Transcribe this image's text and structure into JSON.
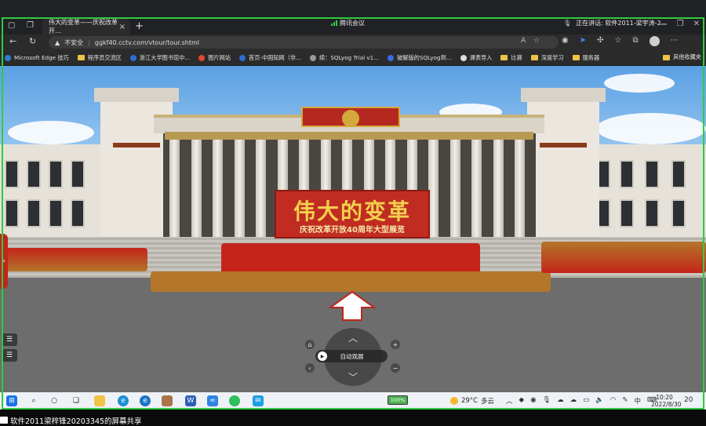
{
  "browser": {
    "tab_title": "伟大的变革——庆祝改革开…",
    "meeting_label": "腾讯会议",
    "speaking_label": "正在讲话: 软件2011-梁宇涛-2...",
    "security_warning": "不安全",
    "url": "ggkf40.cctv.com/vtour/tour.shtml"
  },
  "bookmarks": [
    {
      "label": "Microsoft Edge 技巧",
      "icon": "edge-icon",
      "color": "#2f7fd8"
    },
    {
      "label": "程序员交流区",
      "icon": "folder-icon",
      "color": "#f0c246"
    },
    {
      "label": "浙江大学图书馆中...",
      "icon": "zju-icon",
      "color": "#2d6fd6"
    },
    {
      "label": "图片网站",
      "icon": "site-icon",
      "color": "#e04a2f"
    },
    {
      "label": "首页-中国知网（非...",
      "icon": "cnki-icon",
      "color": "#2f6bd1"
    },
    {
      "label": "续：SQLyog Trial v1...",
      "icon": "sqlyog-icon",
      "color": "#999999"
    },
    {
      "label": "破解版的SQLyog到...",
      "icon": "zhihu-icon",
      "color": "#3a6be0"
    },
    {
      "label": "课表导入",
      "icon": "page-icon",
      "color": "#dddddd"
    },
    {
      "label": "比赛",
      "icon": "folder-icon",
      "color": "#f0c246"
    },
    {
      "label": "深度学习",
      "icon": "folder-icon",
      "color": "#f0c246"
    },
    {
      "label": "服务器",
      "icon": "folder-icon",
      "color": "#f0c246"
    }
  ],
  "bookmarks_other": "其他收藏夹",
  "exhibit": {
    "title": "伟大的变革",
    "subtitle": "庆祝改革开放40周年大型展览",
    "auto_tour_label": "自动观展"
  },
  "taskbar": {
    "battery": "100%",
    "temperature": "29°C",
    "weather": "多云",
    "ime": "中",
    "time": "10:20",
    "date": "2022/8/30",
    "notification_count": "20"
  },
  "share_label": "软件2011梁梓锋20203345的屏幕共享",
  "colors": {
    "share_frame": "#2ecc40",
    "banner_red": "#c12c22",
    "banner_gold": "#f2d04d"
  }
}
